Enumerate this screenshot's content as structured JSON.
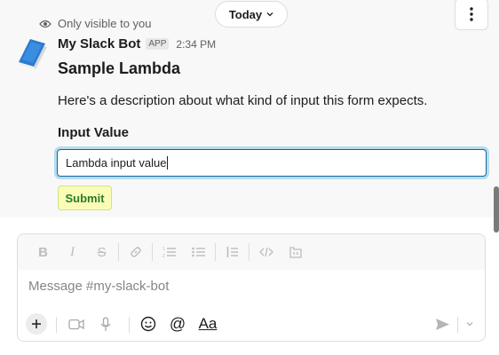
{
  "divider": {
    "label": "Today"
  },
  "message": {
    "visibility_note": "Only visible to you",
    "bot_name": "My Slack Bot",
    "app_badge": "APP",
    "timestamp": "2:34 PM",
    "form_title": "Sample Lambda",
    "description": "Here's a description about what kind of input this form expects.",
    "field_label": "Input Value",
    "field_value": "Lambda input value",
    "submit_label": "Submit"
  },
  "composer": {
    "placeholder": "Message #my-slack-bot",
    "format_icons": [
      "bold-icon",
      "italic-icon",
      "strikethrough-icon",
      "link-icon",
      "ordered-list-icon",
      "bulleted-list-icon",
      "blockquote-icon",
      "code-icon",
      "code-block-icon"
    ],
    "text_format_label": "Aa"
  },
  "colors": {
    "submit_background": "#fafcb5",
    "submit_text": "#2b7a2b",
    "focus_ring": "#1264a3"
  }
}
